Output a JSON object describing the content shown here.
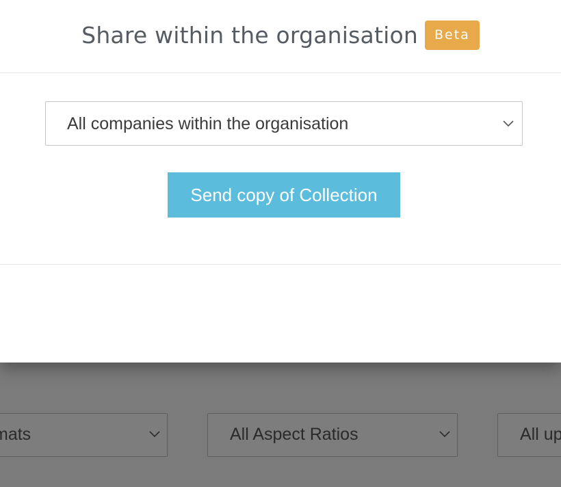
{
  "modal": {
    "title": "Share within the organisation",
    "badge": "Beta",
    "select": {
      "selected": "All companies within the organisation"
    },
    "send_button_label": "Send copy of Collection"
  },
  "background": {
    "filters": {
      "formats_label": "mats",
      "aspect_label": "All Aspect Ratios",
      "uploads_label": "All up"
    }
  },
  "colors": {
    "badge": "#e8a94b",
    "primary_button": "#5bbcdc",
    "overlay": "#7b7b7b"
  },
  "icons": {
    "select_chevron": "chevron-down-icon"
  }
}
